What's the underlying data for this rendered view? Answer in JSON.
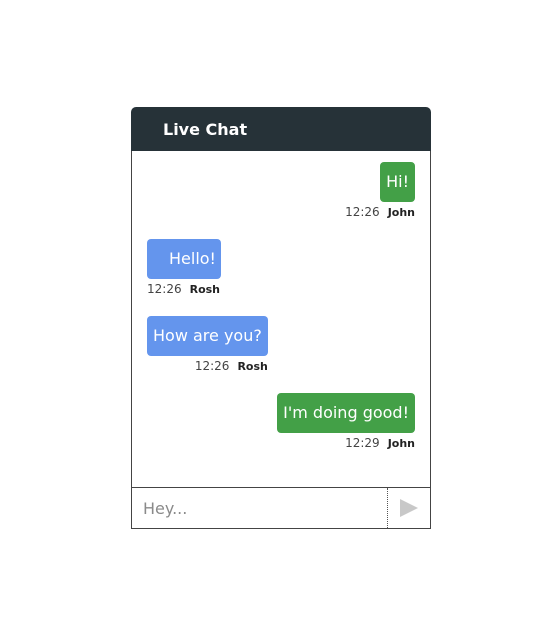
{
  "header": {
    "title": "Live Chat"
  },
  "messages": [
    {
      "text": "Hi!",
      "time": "12:26",
      "author": "John",
      "side": "right",
      "color": "#43a047"
    },
    {
      "text": "Hello!",
      "time": "12:26",
      "author": "Rosh",
      "side": "left",
      "color": "#6495ed"
    },
    {
      "text": "How are you?",
      "time": "12:26",
      "author": "Rosh",
      "side": "left",
      "color": "#6495ed"
    },
    {
      "text": "I'm doing good!",
      "time": "12:29",
      "author": "John",
      "side": "right",
      "color": "#43a047"
    }
  ],
  "input": {
    "placeholder": "Hey..."
  },
  "send": {
    "icon": "send-icon"
  },
  "colors": {
    "header_bg": "#263238",
    "self_bubble": "#43a047",
    "other_bubble": "#6495ed",
    "send_icon": "#c8c8c8"
  }
}
